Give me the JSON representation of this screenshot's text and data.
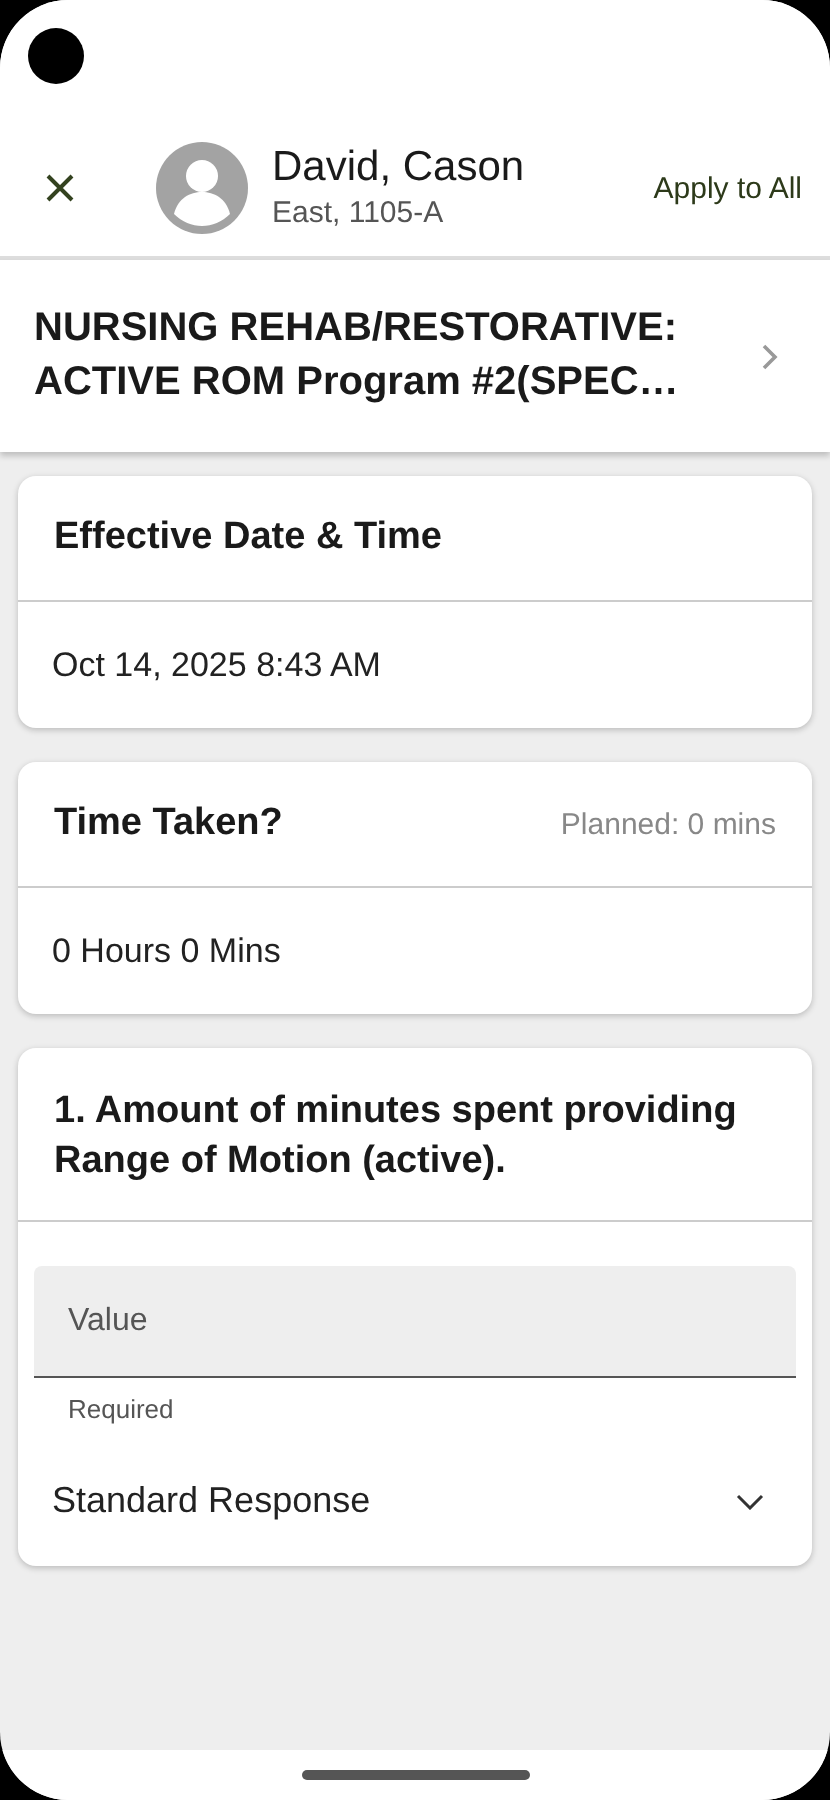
{
  "header": {
    "name": "David, Cason",
    "location": "East, 1105-A",
    "action": "Apply to All"
  },
  "title": "NURSING REHAB/RESTORATIVE: ACTIVE ROM Program #2(SPEC…",
  "cards": [
    {
      "title": "Effective Date & Time",
      "value": "Oct 14, 2025 8:43 AM"
    },
    {
      "title": "Time Taken?",
      "note": "Planned: 0 mins",
      "value": "0 Hours 0 Mins"
    }
  ],
  "question": {
    "title": "1. Amount of minutes spent providing Range of Motion (active).",
    "placeholder": "Value",
    "helper": "Required",
    "response": "Standard Response"
  }
}
